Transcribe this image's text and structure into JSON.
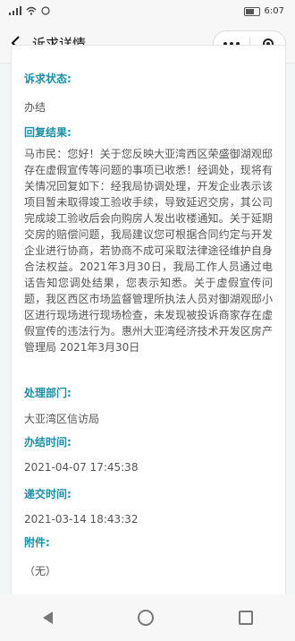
{
  "status_bar": {
    "left_icons": [
      "signal-icon",
      "wifi-icon",
      "message-icon"
    ],
    "time": "6:07"
  },
  "nav": {
    "title": "诉求详情"
  },
  "detail": {
    "status_label": "诉求状态:",
    "status_value": "办结",
    "reply_label": "回复结果:",
    "reply_text": "马市民：您好！关于您反映大亚湾西区荣盛御湖观邸存在虚假宣传等问题的事项已收悉！经调处，现将有关情况回复如下：经我局协调处理，开发企业表示该项目暂未取得竣工验收手续，导致延迟交房，其公司完成竣工验收后会向购房人发出收楼通知。关于延期交房的赔偿问题，我局建议您可根据合同约定与开发企业进行协商，若协商不成可采取法律途径维护自身合法权益。2021年3月30日，我局工作人员通过电话告知您调处结果，您表示知悉。关于虚假宣传问题，我区西区市场监督管理所执法人员对御湖观邸小区进行现场进行现场检查，未发现被投诉商家存在虚假宣传的违法行为。惠州大亚湾经济技术开发区房产管理局 2021年3月30日",
    "dept_label": "处理部门:",
    "dept_value": "大亚湾区信访局",
    "done_label": "办结时间:",
    "done_value": "2021-04-07 17:45:38",
    "submit_label": "递交时间:",
    "submit_value": "2021-03-14 18:43:32",
    "attach_label": "附件:",
    "attach_value": "（无）"
  }
}
